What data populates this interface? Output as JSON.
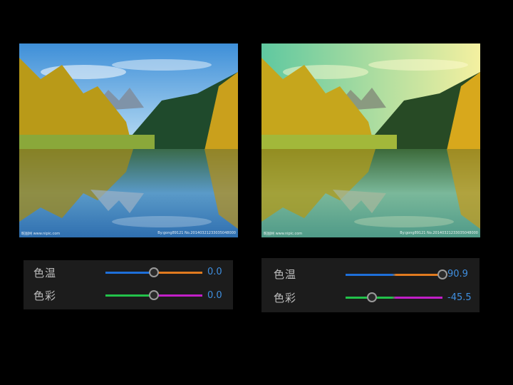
{
  "left": {
    "temp_label": "色温",
    "tint_label": "色彩",
    "temp_value": "0.0",
    "tint_value": "0.0",
    "temp_fraction": 0.5,
    "tint_fraction": 0.5
  },
  "right": {
    "temp_label": "色温",
    "tint_label": "色彩",
    "temp_value": "90.9",
    "tint_value": "-45.5",
    "temp_fraction": 1.0,
    "tint_fraction": 0.27
  },
  "watermark": {
    "left_text": "昵图网 www.nipic.com",
    "right_text": "By:gong89121 No.20140321233035048000"
  },
  "colors": {
    "temp_track": [
      "#1e6fd9",
      "#e07a1f"
    ],
    "tint_track": [
      "#22c24a",
      "#c21fc8"
    ],
    "value_text": "#3f8fe0"
  }
}
